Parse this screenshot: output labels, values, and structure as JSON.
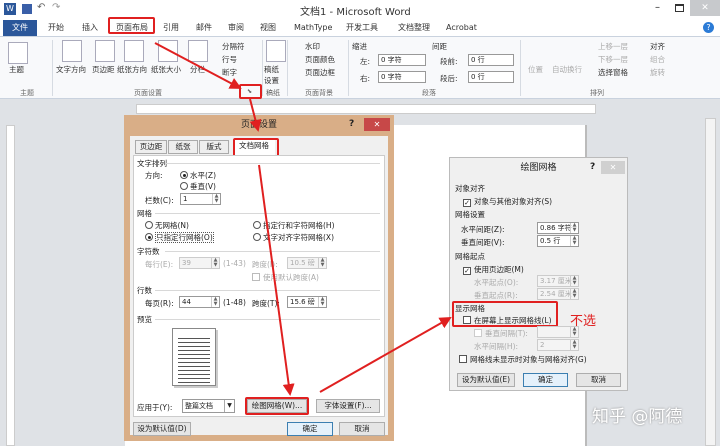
{
  "window": {
    "title": "文档1 - Microsoft Word",
    "quick_access": [
      "save",
      "undo",
      "redo"
    ]
  },
  "tabs": [
    "文件",
    "开始",
    "插入",
    "页面布局",
    "引用",
    "邮件",
    "审阅",
    "视图",
    "MathType",
    "开发工具",
    "文档整理",
    "Acrobat"
  ],
  "active_tab": "页面布局",
  "ribbon": {
    "theme": {
      "label": "主题",
      "group": "主题"
    },
    "page_setup": {
      "items": [
        "文字方向",
        "页边距",
        "纸张方向",
        "纸张大小",
        "分栏"
      ],
      "small": [
        "分隔符",
        "行号",
        "断字"
      ],
      "group": "页面设置"
    },
    "draft": {
      "label": "稿纸设置",
      "group": "稿纸"
    },
    "page_bg": {
      "items": [
        "水印",
        "页面颜色",
        "页面边框"
      ],
      "group": "页面背景"
    },
    "paragraph": {
      "indent": "缩进",
      "spacing": "间距",
      "left": "左:",
      "right": "右:",
      "left_val": "0 字符",
      "right_val": "0 字符",
      "before": "段前:",
      "after": "段后:",
      "before_val": "0 行",
      "after_val": "0 行",
      "group": "段落"
    },
    "arrange": {
      "items": [
        "位置",
        "自动换行"
      ],
      "small": [
        "上移一层",
        "下移一层",
        "选择窗格",
        "对齐",
        "组合",
        "旋转"
      ],
      "group": "排列"
    }
  },
  "page_setup_dialog": {
    "title": "页面设置",
    "tabs": [
      "页边距",
      "纸张",
      "版式",
      "文档网格"
    ],
    "active_tab": "文档网格",
    "text_arrange": {
      "title": "文字排列",
      "direction": "方向:",
      "horizontal": "水平(Z)",
      "vertical": "垂直(V)",
      "selected": "水平(Z)",
      "columns_label": "栏数(C):",
      "columns": "1"
    },
    "grid": {
      "title": "网格",
      "options": [
        "无网格(N)",
        "指定行和字符网格(H)",
        "只指定行网格(O)",
        "文字对齐字符网格(X)"
      ],
      "selected": "只指定行网格(O)"
    },
    "chars": {
      "title": "字符数",
      "per_line": "每行(E):",
      "per_line_val": "39",
      "range": "(1-43)",
      "pitch": "跨度(I):",
      "pitch_val": "10.5 磅",
      "use_default": "使用默认跨度(A)"
    },
    "lines": {
      "title": "行数",
      "per_page": "每页(R):",
      "per_page_val": "44",
      "range": "(1-48)",
      "pitch": "跨度(T):",
      "pitch_val": "15.6 磅"
    },
    "preview": "预览",
    "apply_to_label": "应用于(Y):",
    "apply_to": "整篇文档",
    "drawing_grid_btn": "绘图网格(W)...",
    "font_settings_btn": "字体设置(F)...",
    "set_default": "设为默认值(D)",
    "ok": "确定",
    "cancel": "取消",
    "help": "?"
  },
  "drawing_grid_dialog": {
    "title": "绘图网格",
    "snap": {
      "title": "对象对齐",
      "snap_to_objects": "对象与其他对象对齐(S)",
      "checked": true
    },
    "grid_settings": {
      "title": "网格设置",
      "h_spacing": "水平间距(Z):",
      "h_val": "0.86 字符",
      "v_spacing": "垂直间距(V):",
      "v_val": "0.5 行"
    },
    "origin": {
      "title": "网格起点",
      "use_margins": "使用页边距(M)",
      "checked": true,
      "h_origin": "水平起点(O):",
      "h_val": "3.17 厘米",
      "v_origin": "垂直起点(R):",
      "v_val": "2.54 厘米"
    },
    "show": {
      "title": "显示网格",
      "display_on_screen": "在屏幕上显示网格线(L)",
      "checked": false,
      "vertical_every": "垂直间隔(T):",
      "horizontal_every": "水平间隔(H):",
      "h_every_val": "2",
      "snap_when_off": "网格线未显示时对象与网格对齐(G)"
    },
    "set_default": "设为默认值(E)",
    "ok": "确定",
    "cancel": "取消",
    "help": "?"
  },
  "annotation": "不选",
  "watermark": "知乎 @阿德",
  "colors": {
    "accent": "#2b579a",
    "highlight": "#e02020",
    "dialog_frame": "#d9ae87"
  }
}
